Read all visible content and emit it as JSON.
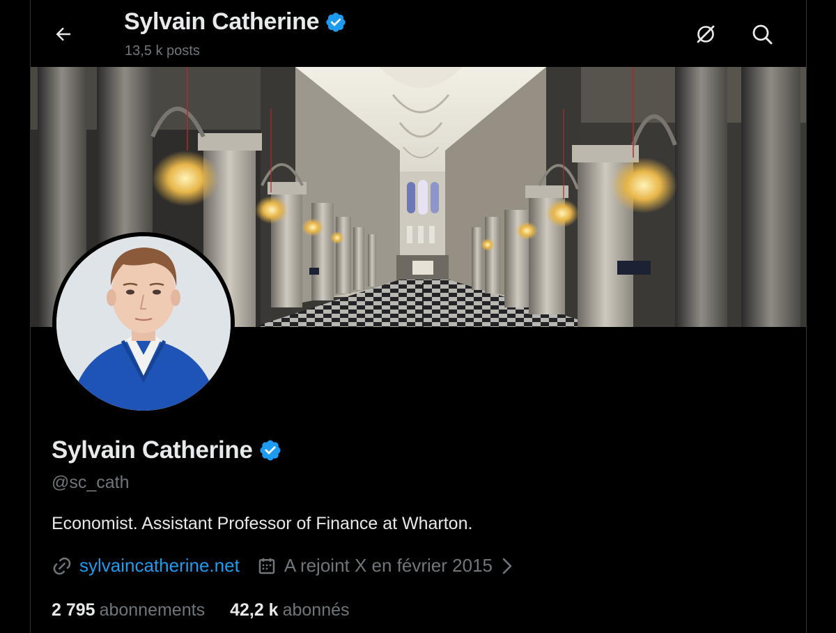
{
  "header": {
    "title": "Sylvain Catherine",
    "posts_count": "13,5 k posts",
    "back_icon": "arrow-left-icon",
    "grok_icon": "grok-icon",
    "search_icon": "search-icon"
  },
  "profile": {
    "display_name": "Sylvain Catherine",
    "verified": true,
    "handle": "@sc_cath",
    "bio": "Economist. Assistant Professor of Finance at Wharton.",
    "website": "sylvaincatherine.net",
    "joined": "A rejoint X en février 2015",
    "following_count": "2 795",
    "following_label": "abonnements",
    "followers_count": "42,2 k",
    "followers_label": "abonnés"
  },
  "colors": {
    "background": "#000000",
    "text_primary": "#e7e9ea",
    "text_secondary": "#71767b",
    "accent": "#1d9bf0"
  }
}
